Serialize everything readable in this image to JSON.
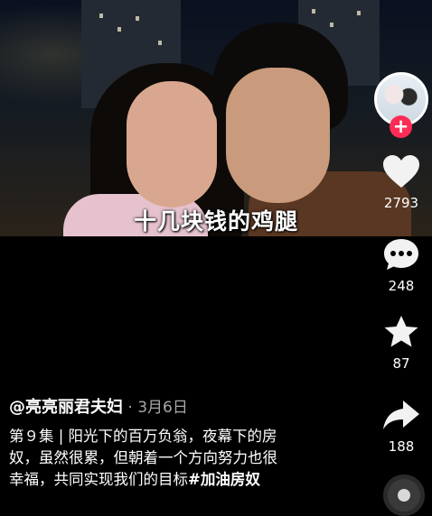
{
  "video": {
    "caption": "十几块钱的鸡腿"
  },
  "sidebar": {
    "follow_symbol": "+",
    "likes": "2793",
    "comments": "248",
    "favorites": "87",
    "shares": "188"
  },
  "post": {
    "author": "@亮亮丽君夫妇",
    "separator": " · ",
    "date": "3月6日",
    "description_lines": [
      "第９集 | 阳光下的百万负翁，夜幕下的房",
      "奴，虽然很累，但朝着一个方向努力也很",
      "幸福，共同实现我们的目标"
    ],
    "hashtag": "#加油房奴"
  },
  "colors": {
    "accent": "#fe2c55",
    "background": "#000000"
  }
}
